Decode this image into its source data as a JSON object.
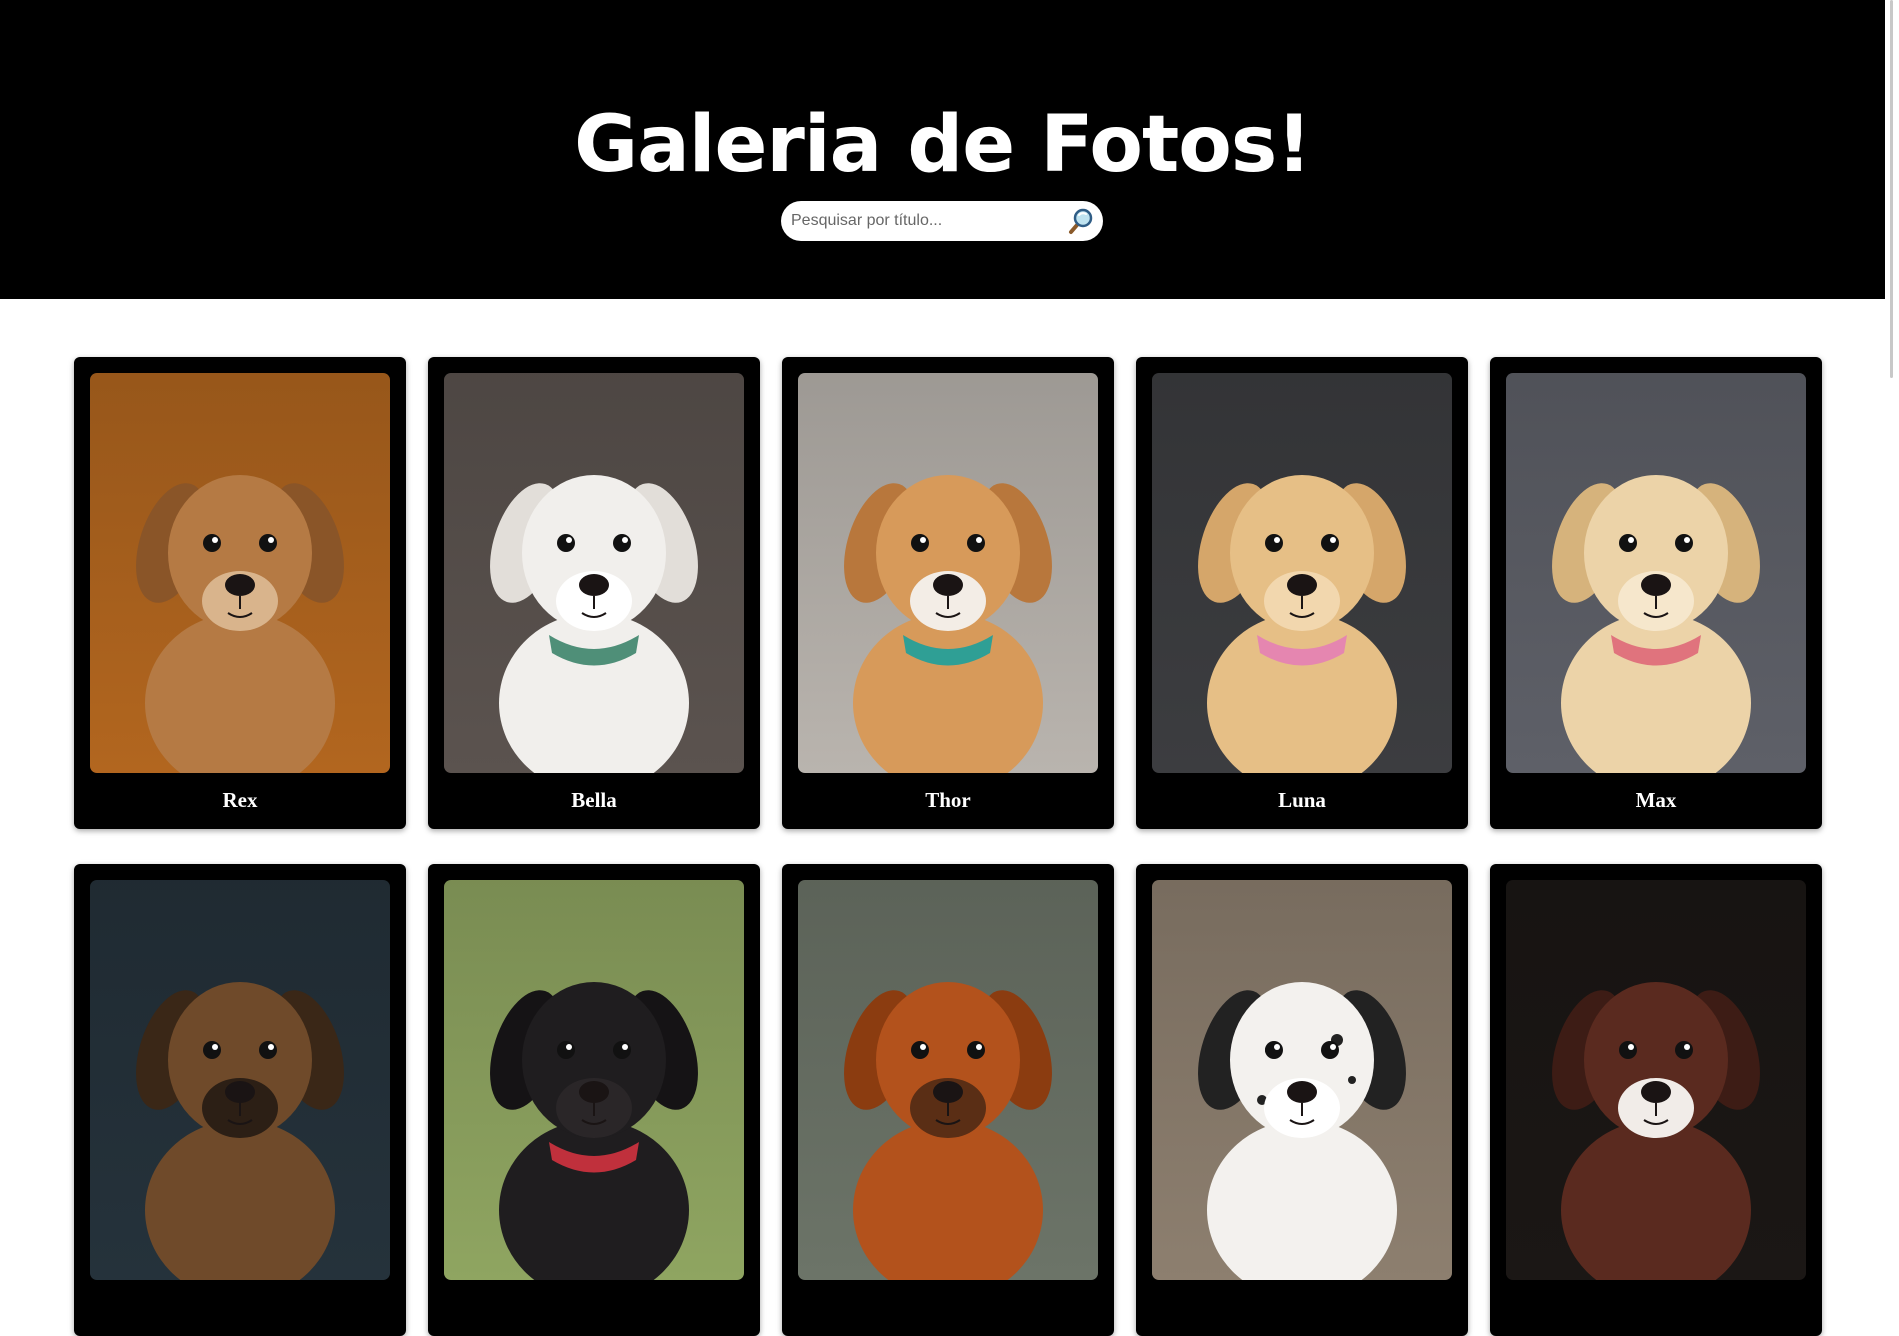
{
  "header": {
    "title": "Galeria de Fotos!",
    "search": {
      "placeholder": "Pesquisar por título...",
      "button_icon": "search-icon"
    }
  },
  "gallery": {
    "items": [
      {
        "title": "Rex",
        "bg": "#b2661f",
        "fur": "#b57a44",
        "ear": "#8a5528",
        "muzzle": "#d9b48c"
      },
      {
        "title": "Bella",
        "bg": "#5b534f",
        "fur": "#f1efec",
        "ear": "#e2ded9",
        "muzzle": "#ffffff",
        "accent": "#4f8f78"
      },
      {
        "title": "Thor",
        "bg": "#b9b4ae",
        "fur": "#d79a5a",
        "ear": "#b8773c",
        "muzzle": "#f3ede6",
        "accent": "#2f9f95"
      },
      {
        "title": "Luna",
        "bg": "#3c3d40",
        "fur": "#e6bf86",
        "ear": "#d5a66a",
        "muzzle": "#f2d7ae",
        "accent": "#e586b0"
      },
      {
        "title": "Max",
        "bg": "#5e6068",
        "fur": "#ecd3a8",
        "ear": "#d6b37c",
        "muzzle": "#f6e7cc",
        "accent": "#e0737d"
      },
      {
        "title": "",
        "bg": "#25323b",
        "fur": "#6f4a2a",
        "ear": "#3a2717",
        "muzzle": "#2c1f15"
      },
      {
        "title": "",
        "bg": "#8fa561",
        "fur": "#1f1d1f",
        "ear": "#151315",
        "muzzle": "#2a2628",
        "accent": "#c0303c"
      },
      {
        "title": "",
        "bg": "#6c7468",
        "fur": "#b3521c",
        "ear": "#8b3c10",
        "muzzle": "#5a2e15"
      },
      {
        "title": "",
        "bg": "#8d7f6f",
        "fur": "#f3f1ee",
        "ear": "#222222",
        "muzzle": "#ffffff"
      },
      {
        "title": "",
        "bg": "#1b1715",
        "fur": "#5a2a1f",
        "ear": "#3d1c15",
        "muzzle": "#f1ece8"
      }
    ]
  }
}
